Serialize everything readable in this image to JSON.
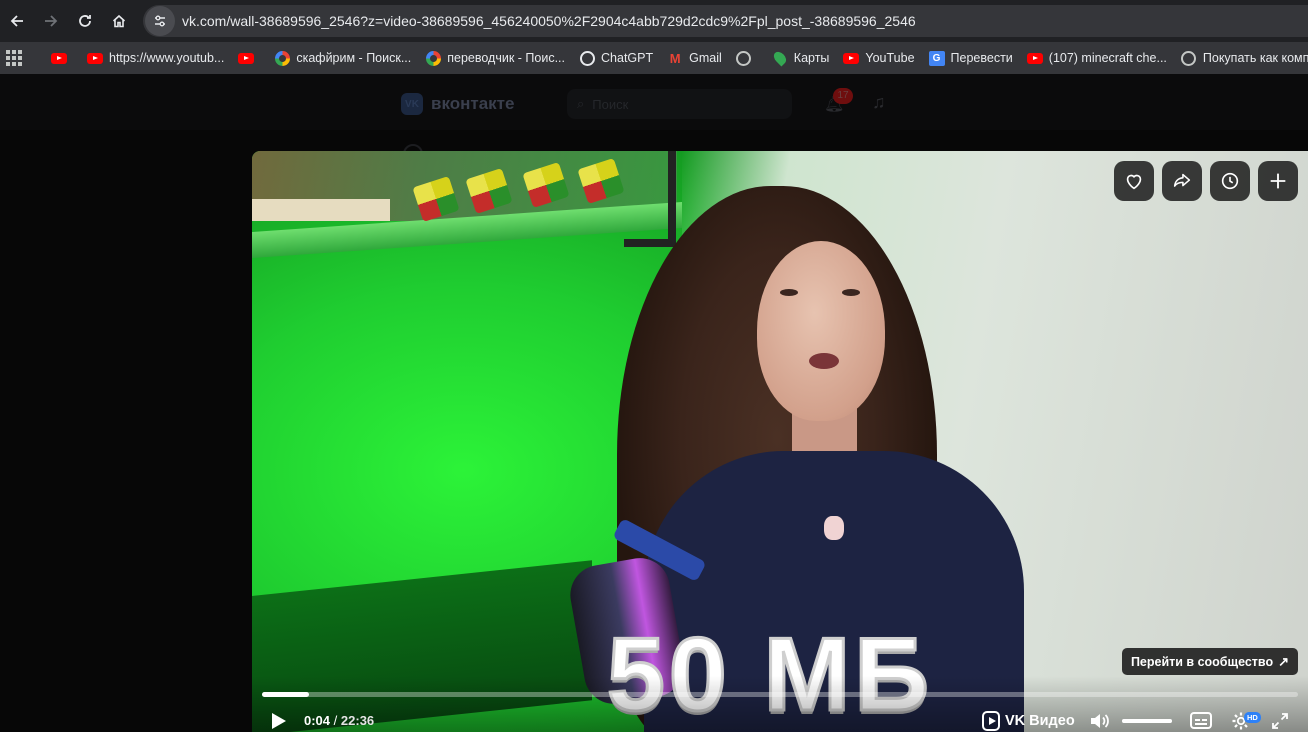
{
  "browser": {
    "url": "vk.com/wall-38689596_2546?z=video-38689596_456240050%2F2904c4abb729d2cdc9%2Fpl_post_-38689596_2546",
    "nav": {
      "back": "back-icon",
      "forward": "forward-icon",
      "reload": "reload-icon",
      "home": "home-icon"
    },
    "bookmarks": [
      {
        "label": "",
        "icon": "youtube-icon"
      },
      {
        "label": "https://www.youtub...",
        "icon": "youtube-icon"
      },
      {
        "label": "",
        "icon": "youtube-icon"
      },
      {
        "label": "скафйрим - Поиск...",
        "icon": "google-icon"
      },
      {
        "label": "переводчик - Поис...",
        "icon": "google-icon"
      },
      {
        "label": "ChatGPT",
        "icon": "chatgpt-icon"
      },
      {
        "label": "Gmail",
        "icon": "gmail-icon"
      },
      {
        "label": "",
        "icon": "globe-icon"
      },
      {
        "label": "Карты",
        "icon": "maps-icon"
      },
      {
        "label": "YouTube",
        "icon": "youtube-icon"
      },
      {
        "label": "Перевести",
        "icon": "translate-icon"
      },
      {
        "label": "(107) minecraft che...",
        "icon": "youtube-icon"
      },
      {
        "label": "Покупать как комп...",
        "icon": "globe-icon"
      }
    ]
  },
  "vk": {
    "logo_text": "вконтакте",
    "search_placeholder": "Поиск",
    "notifications_count": "17"
  },
  "player": {
    "actions": [
      {
        "name": "like-button",
        "icon": "heart-icon"
      },
      {
        "name": "share-button",
        "icon": "share-arrow-icon"
      },
      {
        "name": "watch-later-button",
        "icon": "clock-icon"
      },
      {
        "name": "add-to-playlist-button",
        "icon": "plus-icon"
      }
    ],
    "caption": "50 МБ",
    "community_button": "Перейти в сообщество",
    "current_time": "0:04",
    "separator": "/",
    "total_time": "22:36",
    "progress_fraction": 0.045,
    "brand": "VK Видео",
    "volume_fraction": 1.0,
    "quality_badge": "HD"
  },
  "colors": {
    "browser_bg": "#202124",
    "toolbar_bg": "#35363a",
    "accent_hd": "#2d81f7",
    "player_overlay": "#141414"
  }
}
